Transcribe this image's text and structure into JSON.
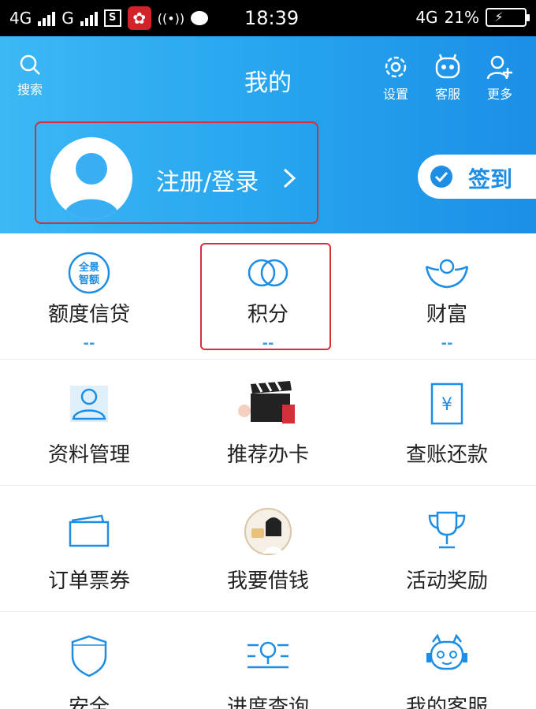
{
  "status_bar": {
    "network1": "4G",
    "network2": "G",
    "badge": "S",
    "time": "18:39",
    "network3": "4G",
    "battery_pct": "21%"
  },
  "header": {
    "search_label": "搜索",
    "title": "我的",
    "settings_label": "设置",
    "service_label": "客服",
    "more_label": "更多",
    "login_label": "注册/登录",
    "signin_label": "签到"
  },
  "stats": [
    {
      "label": "额度信贷",
      "value": "--",
      "icon": "quota-credit-icon",
      "icon_text": "全景\n智额"
    },
    {
      "label": "积分",
      "value": "--",
      "icon": "points-icon"
    },
    {
      "label": "财富",
      "value": "--",
      "icon": "wealth-icon"
    }
  ],
  "menu": [
    [
      {
        "label": "资料管理",
        "icon": "profile-icon"
      },
      {
        "label": "推荐办卡",
        "icon": "clapperboard-icon"
      },
      {
        "label": "查账还款",
        "icon": "bill-icon",
        "icon_text": "¥"
      }
    ],
    [
      {
        "label": "订单票券",
        "icon": "ticket-icon"
      },
      {
        "label": "我要借钱",
        "icon": "loan-avatar-icon"
      },
      {
        "label": "活动奖励",
        "icon": "trophy-icon"
      }
    ],
    [
      {
        "label": "安全",
        "icon": "shield-icon"
      },
      {
        "label": "进度查询",
        "icon": "progress-search-icon"
      },
      {
        "label": "我的客服",
        "icon": "service-robot-icon"
      }
    ]
  ],
  "colors": {
    "header_start": "#3cb8f5",
    "header_end": "#1c8fe6",
    "accent": "#1e8ee4",
    "highlight_border": "#d3303a"
  }
}
